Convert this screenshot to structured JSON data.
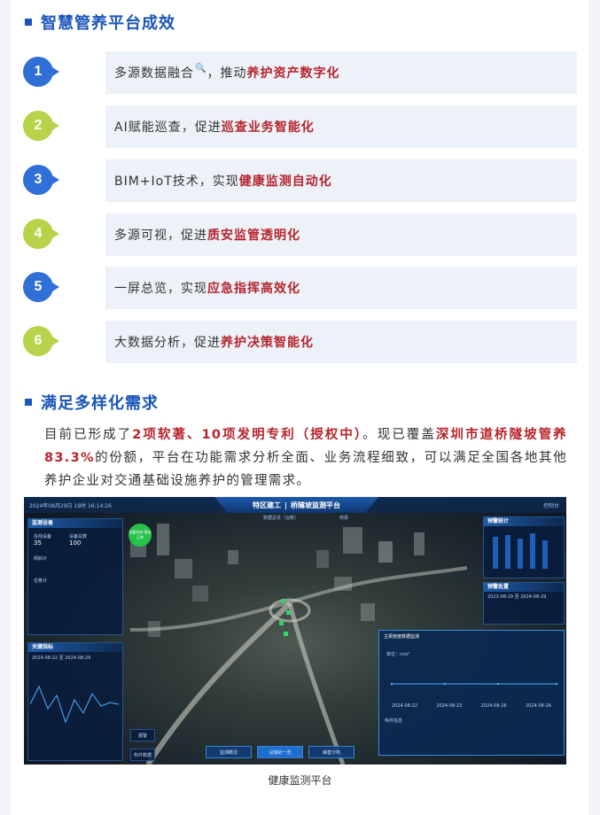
{
  "section1": {
    "title": "智慧管养平台成效"
  },
  "items": [
    {
      "num": "1",
      "color": "blue",
      "pre": "多源数据融合",
      "mag": "🔍",
      "mid": "，推动",
      "hl": "养护资产数字化"
    },
    {
      "num": "2",
      "color": "green",
      "pre": "AI赋能巡查，促进",
      "mag": "",
      "mid": "",
      "hl": "巡查业务智能化"
    },
    {
      "num": "3",
      "color": "blue",
      "pre": "BIM+IoT技术，实现",
      "mag": "",
      "mid": "",
      "hl": "健康监测自动化"
    },
    {
      "num": "4",
      "color": "green",
      "pre": "多源可视，促进",
      "mag": "",
      "mid": "",
      "hl": "质安监管透明化"
    },
    {
      "num": "5",
      "color": "blue",
      "pre": "一屏总览，实现",
      "mag": "",
      "mid": "",
      "hl": "应急指挥高效化"
    },
    {
      "num": "6",
      "color": "green",
      "pre": "大数据分析，促进",
      "mag": "",
      "mid": "",
      "hl": "养护决策智能化"
    }
  ],
  "section2": {
    "title": "满足多样化需求"
  },
  "paragraph": {
    "t1": "目前已形成了",
    "h1": "2项软著、10项发明专利（授权中）",
    "t2": "。现已覆盖",
    "h2": "深圳市道桥隧坡管养83.3%",
    "t3": "的份额，平台在功能需求分析全面、业务流程细致，可以满足全国各地其他养护企业对交通基础设施养护的管理需求。"
  },
  "dashboard": {
    "time": "2024年08月29日 19时 16:14:26",
    "brand": "特区建工",
    "title": "桥隧坡监测平台",
    "subtabs": [
      "数据总览（台账）",
      "桥梁"
    ],
    "control": "控制台",
    "left_panel_title": "监测设备",
    "left_stats": [
      {
        "label": "在线设备",
        "value": "35"
      },
      {
        "label": "设备总数",
        "value": "100"
      }
    ],
    "left_rows": [
      "倾斜计",
      "位移计"
    ],
    "left_bottom_title": "关键指标",
    "left_bottom_date": "2024-08-22 至 2024-08-29",
    "right_panel_title": "预警统计",
    "right_panel2_title": "预警处置",
    "right_panel2_date": "2023-08-29 至 2024-08-29",
    "bubble": "设备状态 基本正常",
    "popup_title": "主梁挠度数据监测",
    "popup_unit": "单位：m/s²",
    "popup_dates": [
      "2024-08-22",
      "2024-08-22",
      "2024-08-26",
      "2024-08-26"
    ],
    "popup_footer": "构件信息",
    "bottom_tabs": [
      "监测概况",
      "设施的一览",
      "病害分布"
    ],
    "left_buttons": [
      "报警",
      "构件数据"
    ]
  },
  "caption": "健康监测平台",
  "colors": {
    "accent": "#1a56b8",
    "highlight": "#b5252d",
    "blue_circle": "#2f6fd6",
    "green_circle": "#b6d34a"
  }
}
